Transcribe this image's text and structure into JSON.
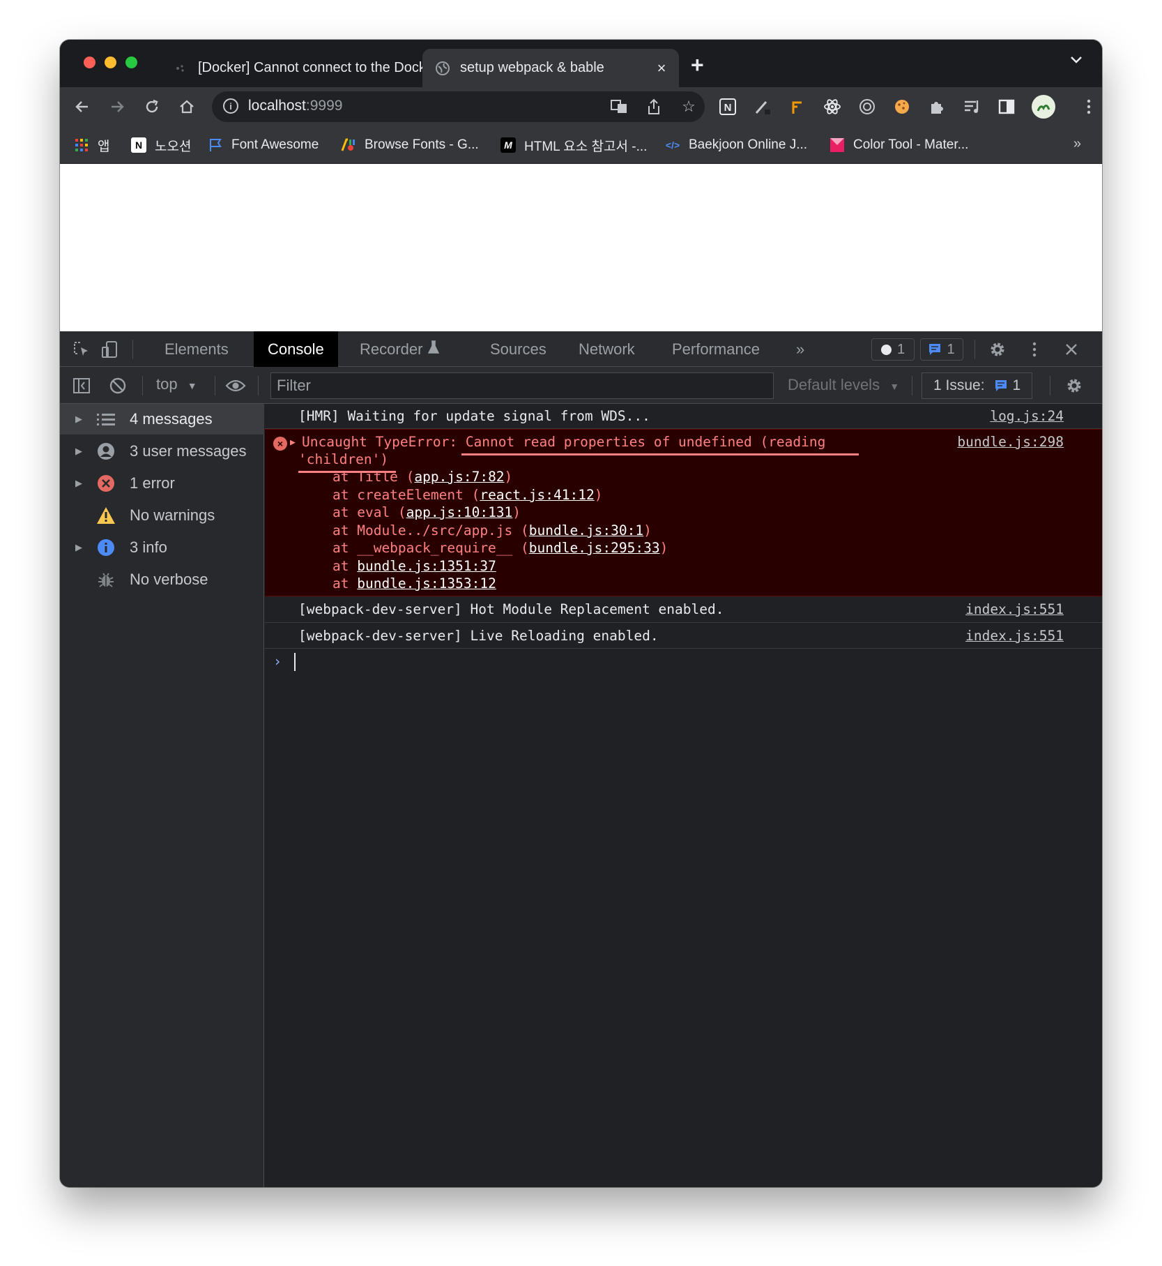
{
  "tabs": [
    {
      "title": "[Docker] Cannot connect to the Docker daemon",
      "close": "×",
      "icon": "docker-icon"
    },
    {
      "title": "setup webpack & bable",
      "close": "×",
      "icon": "globe-icon"
    }
  ],
  "new_tab": "+",
  "address": {
    "host": "localhost",
    "port": ":9999"
  },
  "bookmarks": [
    {
      "label": "앱",
      "icon": "apps-grid-icon"
    },
    {
      "label": "노오션",
      "icon": "notion-icon"
    },
    {
      "label": "Font Awesome",
      "icon": "flag-icon"
    },
    {
      "label": "Browse Fonts - G...",
      "icon": "google-fonts-icon"
    },
    {
      "label": "HTML 요소 참고서 -...",
      "icon": "mdn-icon"
    },
    {
      "label": "Baekjoon Online J...",
      "icon": "code-icon"
    },
    {
      "label": "Color Tool - Mater...",
      "icon": "material-icon"
    }
  ],
  "bookmarks_more": "»",
  "devtools": {
    "tabs": [
      "Elements",
      "Console",
      "Recorder",
      "Sources",
      "Network",
      "Performance"
    ],
    "more_tabs": "»",
    "error_count": "1",
    "message_count": "1",
    "context": "top",
    "filter_placeholder": "Filter",
    "levels": "Default levels",
    "issues_label": "1 Issue:",
    "issues_count": "1"
  },
  "sidebar": [
    {
      "label": "4 messages",
      "icon": "list-icon",
      "arrow": "▶"
    },
    {
      "label": "3 user messages",
      "icon": "user-icon",
      "arrow": "▶"
    },
    {
      "label": "1 error",
      "icon": "error-icon",
      "arrow": "▶"
    },
    {
      "label": "No warnings",
      "icon": "warning-icon",
      "arrow": ""
    },
    {
      "label": "3 info",
      "icon": "info-icon",
      "arrow": "▶"
    },
    {
      "label": "No verbose",
      "icon": "bug-icon",
      "arrow": ""
    }
  ],
  "console": {
    "messages": [
      {
        "text": "[HMR] Waiting for update signal from WDS...",
        "source": "log.js:24"
      },
      {
        "text": "[webpack-dev-server] Hot Module Replacement enabled.",
        "source": "index.js:551"
      },
      {
        "text": "[webpack-dev-server] Live Reloading enabled.",
        "source": "index.js:551"
      }
    ],
    "error": {
      "line1_prefix": "Uncaught TypeError: ",
      "line1_msg": "Cannot read properties of undefined (reading",
      "line2": "'children')",
      "source": "bundle.js:298",
      "stack": [
        {
          "prefix": "at Title (",
          "link": "app.js:7:82",
          "suffix": ")"
        },
        {
          "prefix": "at createElement (",
          "link": "react.js:41:12",
          "suffix": ")"
        },
        {
          "prefix": "at eval (",
          "link": "app.js:10:131",
          "suffix": ")"
        },
        {
          "prefix": "at Module../src/app.js (",
          "link": "bundle.js:30:1",
          "suffix": ")"
        },
        {
          "prefix": "at __webpack_require__ (",
          "link": "bundle.js:295:33",
          "suffix": ")"
        },
        {
          "prefix": "at ",
          "link": "bundle.js:1351:37",
          "suffix": ""
        },
        {
          "prefix": "at ",
          "link": "bundle.js:1353:12",
          "suffix": ""
        }
      ]
    },
    "prompt": "›"
  }
}
